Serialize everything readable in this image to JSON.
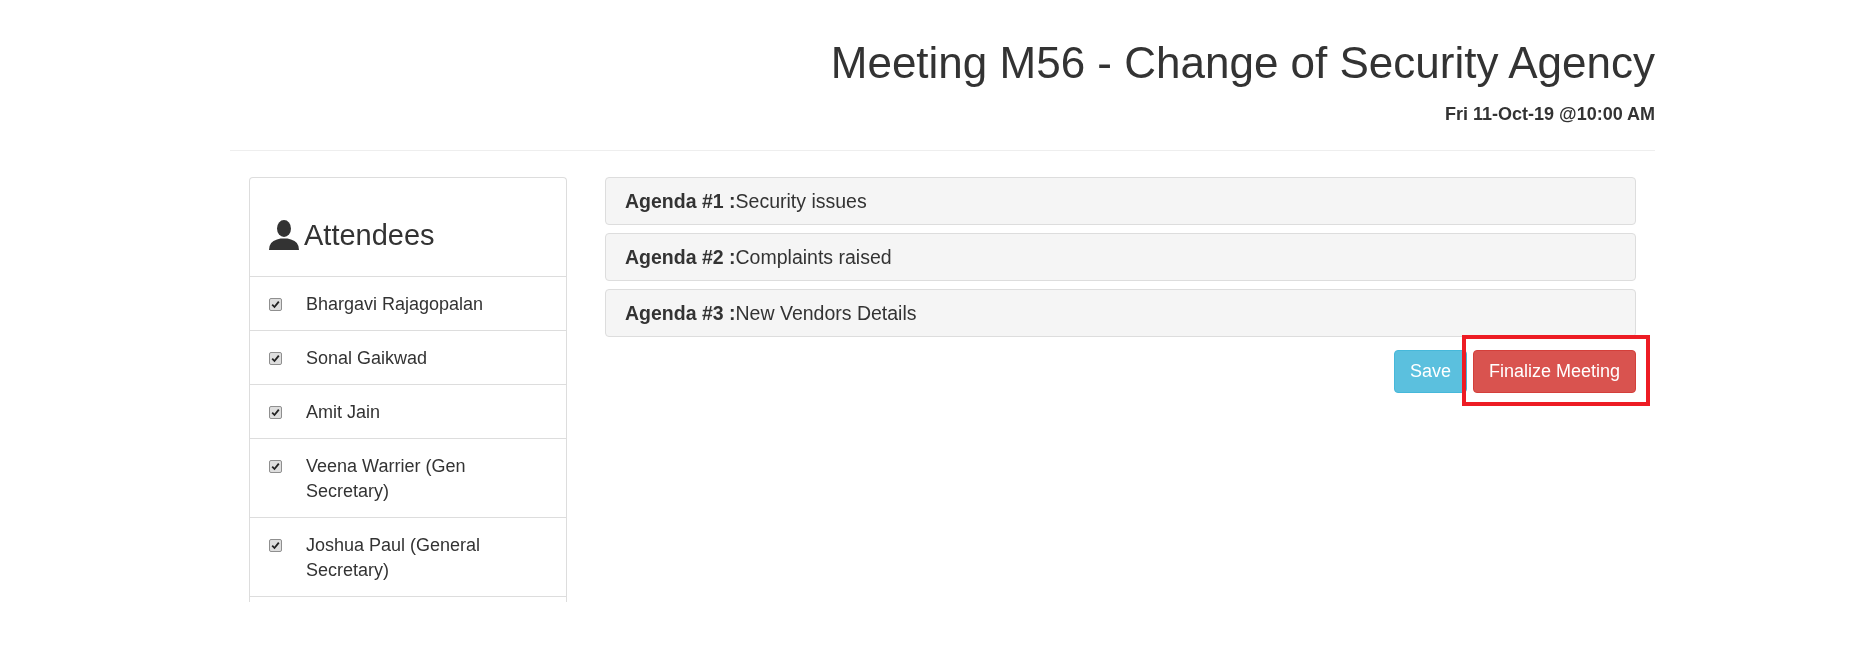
{
  "header": {
    "title": "Meeting M56 - Change of Security Agency",
    "datetime": "Fri 11-Oct-19 @10:00 AM"
  },
  "attendees": {
    "heading": "Attendees",
    "items": [
      {
        "name": "Bhargavi Rajagopalan",
        "checked": true
      },
      {
        "name": "Sonal Gaikwad",
        "checked": true
      },
      {
        "name": "Amit Jain",
        "checked": true
      },
      {
        "name": "Veena Warrier (Gen Secretary)",
        "checked": true
      },
      {
        "name": "Joshua Paul (General Secretary)",
        "checked": true
      }
    ]
  },
  "agenda": [
    {
      "title": "**Agenda #1 :**Security issues"
    },
    {
      "title": "**Agenda #2 :**Complaints raised"
    },
    {
      "title": "**Agenda #3 :**New Vendors Details"
    }
  ],
  "buttons": [
    {
      "label": "Save",
      "kind": "info",
      "highlighted": false
    },
    {
      "label": "Finalize Meeting",
      "kind": "danger",
      "highlighted": true
    }
  ]
}
